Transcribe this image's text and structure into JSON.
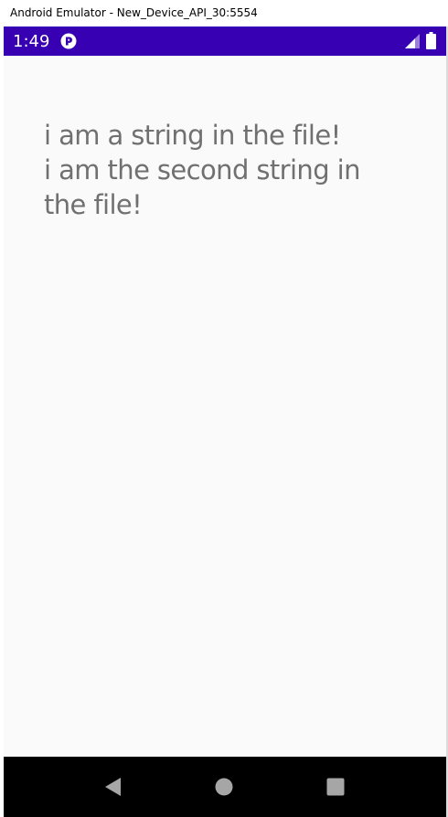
{
  "window": {
    "title": "Android Emulator - New_Device_API_30:5554"
  },
  "status_bar": {
    "time": "1:49",
    "background_color": "#3700b3",
    "icons": [
      "app-notification-icon",
      "signal-icon",
      "battery-icon"
    ]
  },
  "content": {
    "lines": [
      "i am a string in the file!",
      "i am the second string in the file!"
    ],
    "text_color": "#707070",
    "background_color": "#fafafa"
  },
  "nav_bar": {
    "buttons": [
      "back-button",
      "home-button",
      "recents-button"
    ],
    "background_color": "#000000"
  }
}
